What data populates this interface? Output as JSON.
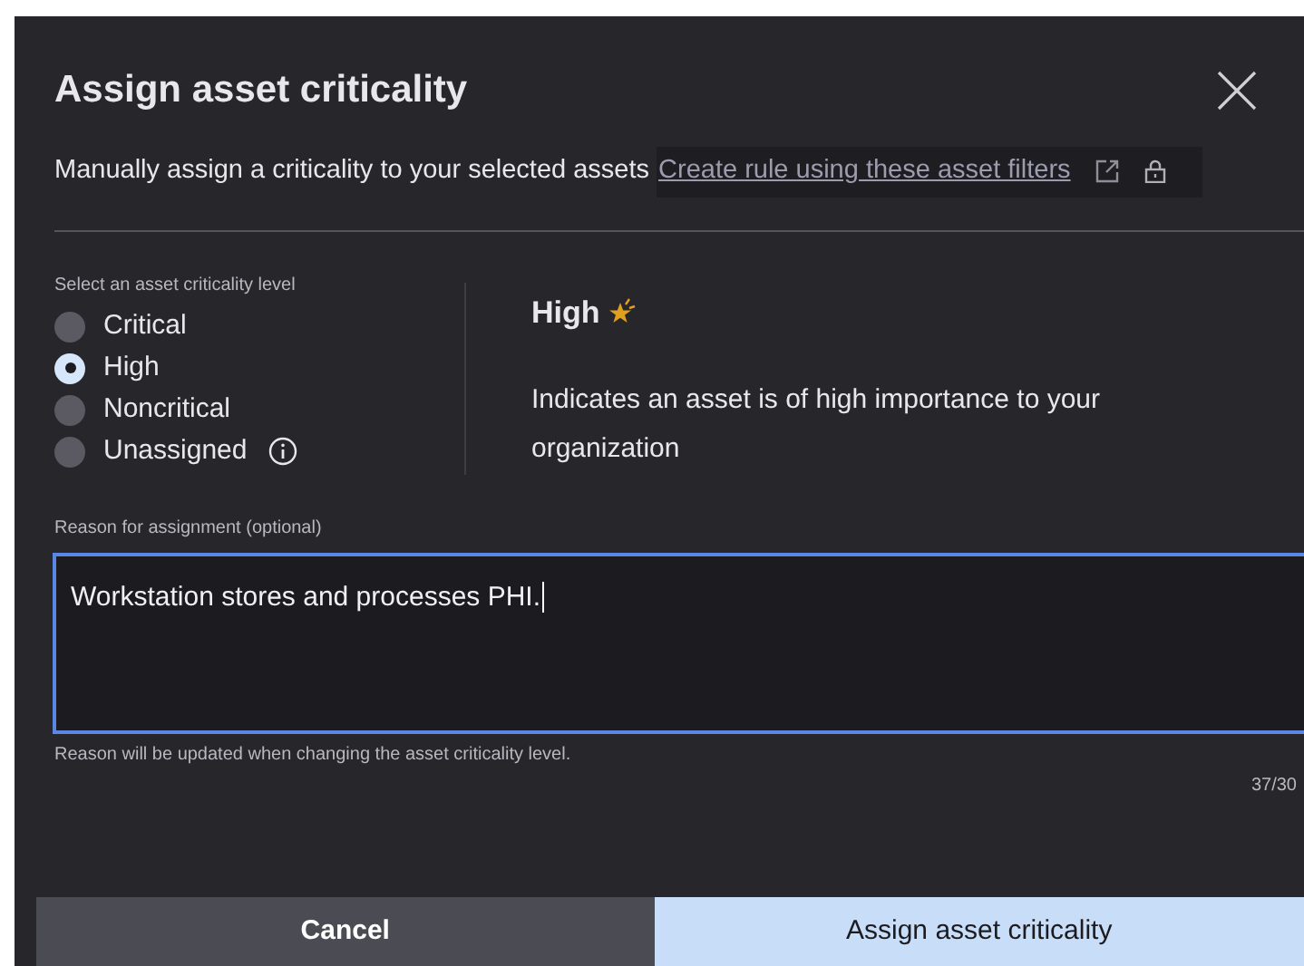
{
  "dialog": {
    "title": "Assign asset criticality",
    "subtitle": "Manually assign a criticality to your selected assets",
    "link": "Create rule using these asset filters"
  },
  "levels": {
    "label": "Select an asset criticality level",
    "options": [
      {
        "label": "Critical",
        "selected": false
      },
      {
        "label": "High",
        "selected": true
      },
      {
        "label": "Noncritical",
        "selected": false
      },
      {
        "label": "Unassigned",
        "selected": false,
        "info": true
      }
    ]
  },
  "detail": {
    "title": "High",
    "starred": true,
    "description": "Indicates an asset is of high importance to your organization"
  },
  "reason": {
    "label": "Reason for assignment (optional)",
    "value": "Workstation stores and processes PHI.",
    "helper": "Reason will be updated when changing the asset criticality level.",
    "count": "37/30"
  },
  "buttons": [
    {
      "label": "Cancel",
      "kind": "secondary"
    },
    {
      "label": "Assign asset criticality",
      "kind": "primary"
    }
  ]
}
